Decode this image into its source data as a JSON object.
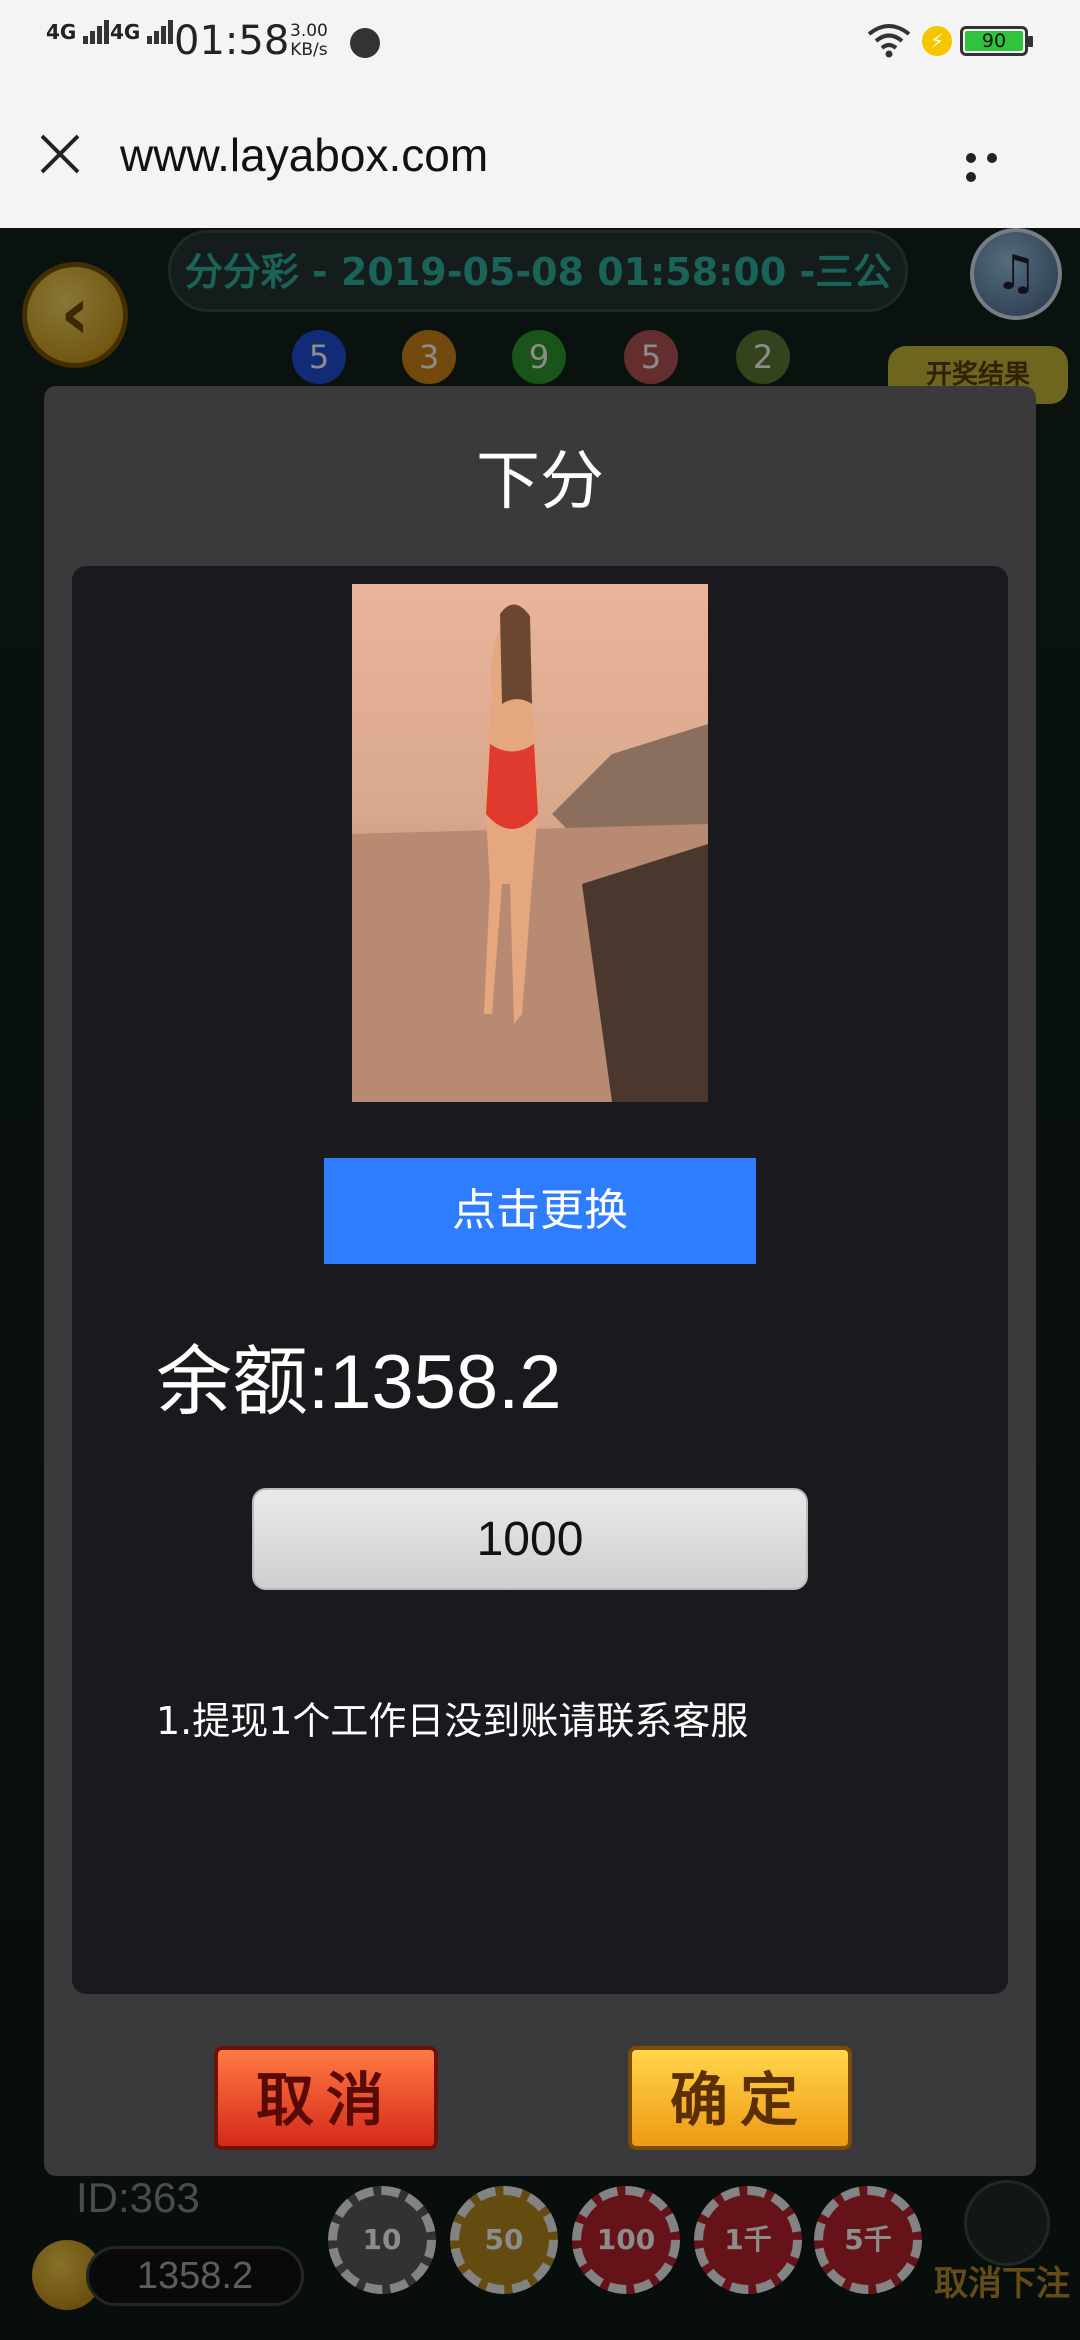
{
  "status_bar": {
    "net1": "4G",
    "net2": "4G",
    "time": "01:58",
    "speed_value": "3.00",
    "speed_unit": "KB/s",
    "battery": "90"
  },
  "browser": {
    "url": "www.layabox.com"
  },
  "game": {
    "title": "分分彩 - 2019-05-08 01:58:00 -三公",
    "balls": [
      "5",
      "3",
      "9",
      "5",
      "2"
    ],
    "result_button": "开奖结果"
  },
  "modal": {
    "title": "下分",
    "change_button": "点击更换",
    "balance_text": "余额:1358.2",
    "amount_value": "1000",
    "note": "1.提现1个工作日没到账请联系客服",
    "cancel_button": "取消",
    "confirm_button": "确定"
  },
  "bottom": {
    "user_id": "ID:363",
    "balance": "1358.2",
    "chips": [
      "10",
      "50",
      "100",
      "1千",
      "5千"
    ],
    "cancel_bet": "取消下注"
  },
  "colors": {
    "accent_blue": "#2f7dff",
    "title_teal": "#31b5a0",
    "battery_green": "#2fc43c"
  }
}
